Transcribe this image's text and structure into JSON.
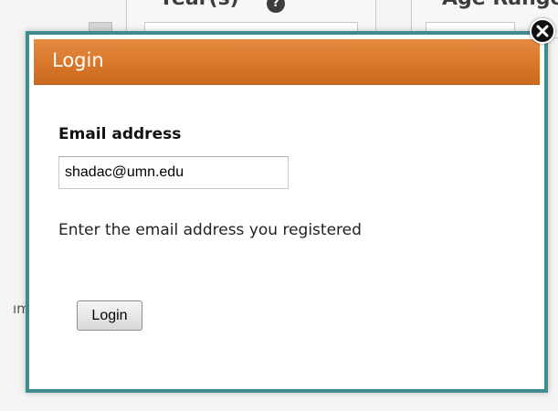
{
  "background": {
    "panel_1_heading": "Year(s)",
    "panel_2_heading": "Age Range",
    "fragment_text": "ım"
  },
  "modal": {
    "title": "Login",
    "email_label": "Email address",
    "email_value": "shadac@umn.edu",
    "help_text": "Enter the email address you registered",
    "login_button_label": "Login",
    "close_icon": "close-icon"
  },
  "colors": {
    "header_orange": "#d9772b",
    "modal_border_teal": "#3f8b8e"
  }
}
